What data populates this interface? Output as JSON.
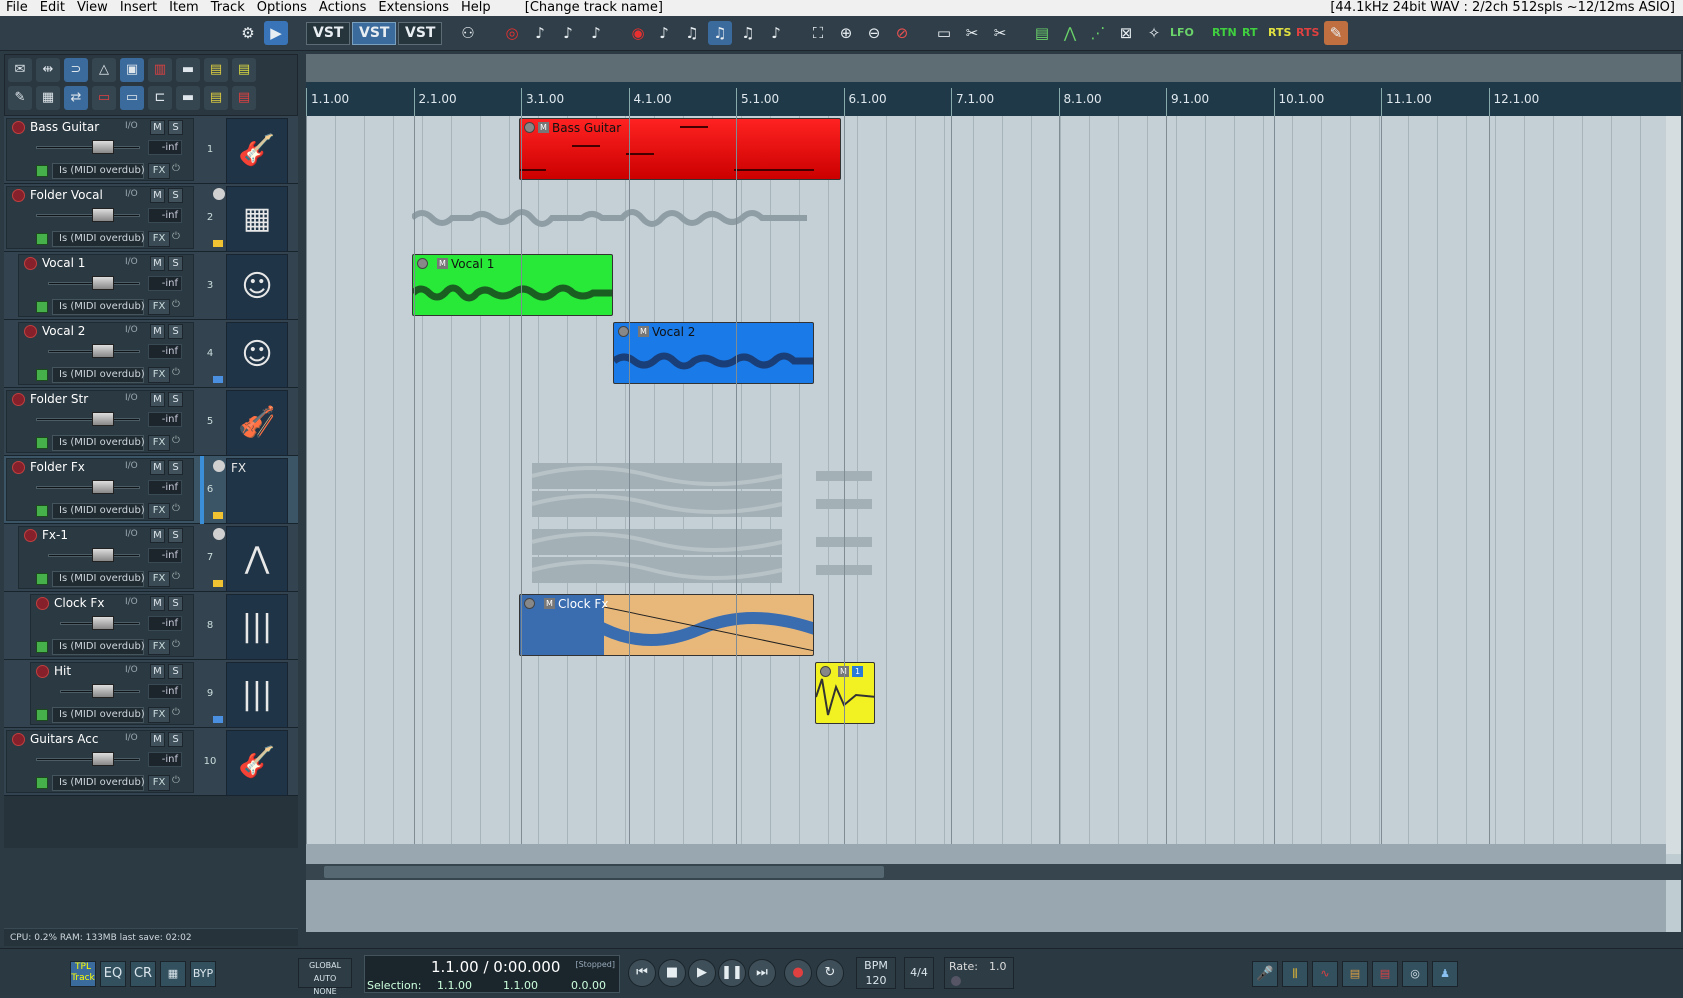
{
  "menu": [
    "File",
    "Edit",
    "View",
    "Insert",
    "Item",
    "Track",
    "Options",
    "Actions",
    "Extensions",
    "Help"
  ],
  "window_title": "[Change track name]",
  "status": "[44.1kHz 24bit WAV : 2/2ch 512spls ~12/12ms ASIO]",
  "toolbar": {
    "vst1": "VST",
    "vst2": "VST",
    "vst3": "VST",
    "lfo": "LFO",
    "rtn": "RTN",
    "rt": "RT",
    "rts1": "RTS",
    "rts2": "RTS"
  },
  "tracks": [
    {
      "name": "Bass Guitar",
      "num": "1",
      "io": "I/O",
      "m": "M",
      "s": "S",
      "db": "-inf",
      "input": "Is (MIDI overdub)",
      "fx": "FX"
    },
    {
      "name": "Folder Vocal",
      "num": "2",
      "io": "I/O",
      "m": "M",
      "s": "S",
      "db": "-inf",
      "input": "Is (MIDI overdub)",
      "fx": "FX"
    },
    {
      "name": "Vocal 1",
      "num": "3",
      "io": "I/O",
      "m": "M",
      "s": "S",
      "db": "-inf",
      "input": "Is (MIDI overdub)",
      "fx": "FX"
    },
    {
      "name": "Vocal 2",
      "num": "4",
      "io": "I/O",
      "m": "M",
      "s": "S",
      "db": "-inf",
      "input": "Is (MIDI overdub)",
      "fx": "FX"
    },
    {
      "name": "Folder Str",
      "num": "5",
      "io": "I/O",
      "m": "M",
      "s": "S",
      "db": "-inf",
      "input": "Is (MIDI overdub)",
      "fx": "FX"
    },
    {
      "name": "Folder Fx",
      "num": "6",
      "io": "I/O",
      "m": "M",
      "s": "S",
      "db": "-inf",
      "input": "Is (MIDI overdub)",
      "fx": "FX"
    },
    {
      "name": "Fx-1",
      "num": "7",
      "io": "I/O",
      "m": "M",
      "s": "S",
      "db": "-inf",
      "input": "Is (MIDI overdub)",
      "fx": "FX"
    },
    {
      "name": "Clock Fx",
      "num": "8",
      "io": "I/O",
      "m": "M",
      "s": "S",
      "db": "-inf",
      "input": "Is (MIDI overdub)",
      "fx": "FX"
    },
    {
      "name": "Hit",
      "num": "9",
      "io": "I/O",
      "m": "M",
      "s": "S",
      "db": "-inf",
      "input": "Is (MIDI overdub)",
      "fx": "FX"
    },
    {
      "name": "Guitars Acc",
      "num": "10",
      "io": "I/O",
      "m": "M",
      "s": "S",
      "db": "-inf",
      "input": "Is (MIDI overdub)",
      "fx": "FX"
    }
  ],
  "ruler": [
    "1.1.00",
    "2.1.00",
    "3.1.00",
    "4.1.00",
    "5.1.00",
    "6.1.00",
    "7.1.00",
    "8.1.00",
    "9.1.00",
    "10.1.00",
    "11.1.00",
    "12.1.00"
  ],
  "items": {
    "bass": "Bass Guitar",
    "vocal1": "Vocal 1",
    "vocal2": "Vocal 2",
    "clock": "Clock Fx",
    "m": "M",
    "hit_badge": "1"
  },
  "thumb_fx": "FX",
  "cpu": "CPU: 0.2%  RAM: 133MB  last save: 02:02",
  "transport": {
    "tpl": "TPL",
    "track": "Track",
    "eq": "EQ",
    "cr": "CR",
    "byp": "BYP",
    "global_auto": "GLOBAL AUTO",
    "none": "NONE",
    "time": "1.1.00 / 0:00.000",
    "state": "[Stopped]",
    "selection_label": "Selection:",
    "sel_start": "1.1.00",
    "sel_end": "1.1.00",
    "sel_len": "0.0.00",
    "bpm_label": "BPM",
    "bpm": "120",
    "sig": "4/4",
    "rate_label": "Rate:",
    "rate": "1.0"
  },
  "colors": {
    "bass": "#e21010",
    "vocal1": "#22e838",
    "vocal2": "#1876e8",
    "clock_a": "#e8b87a",
    "clock_b": "#3a6cb0",
    "hit": "#f2f222"
  }
}
